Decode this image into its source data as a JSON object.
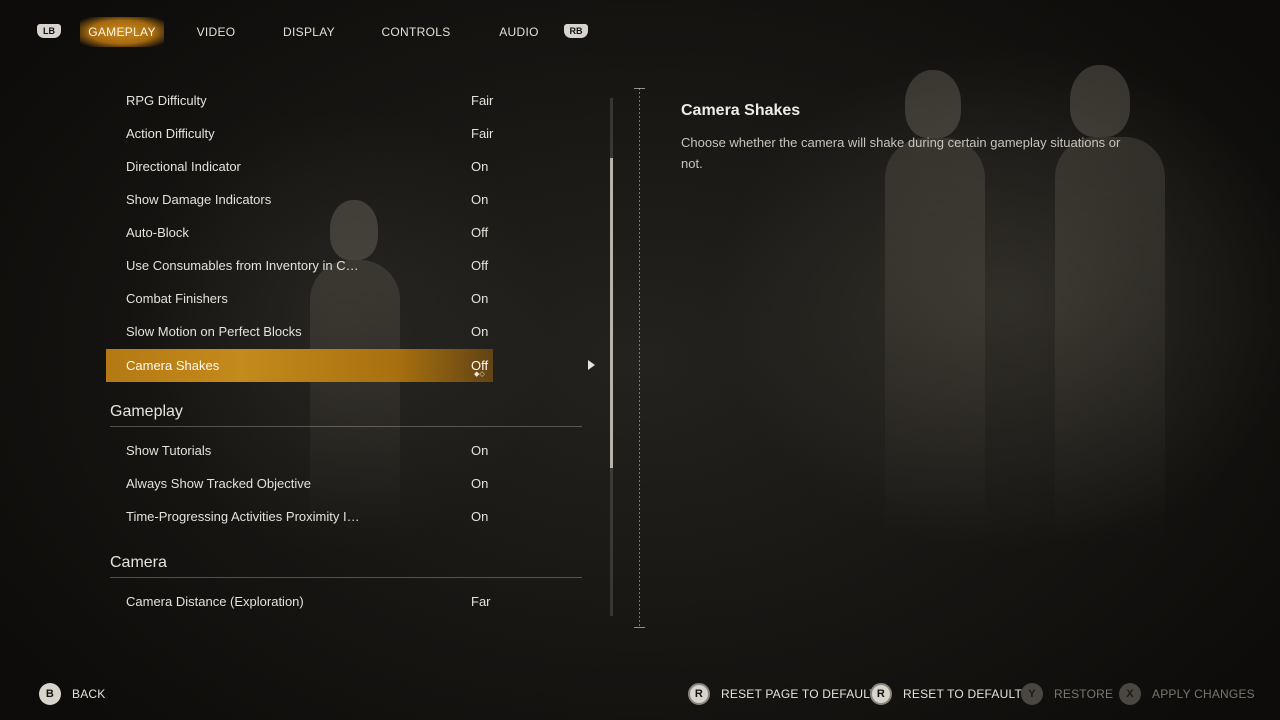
{
  "tabs": {
    "left_bumper": "LB",
    "right_bumper": "RB",
    "items": [
      {
        "label": "GAMEPLAY"
      },
      {
        "label": "VIDEO"
      },
      {
        "label": "DISPLAY"
      },
      {
        "label": "CONTROLS"
      },
      {
        "label": "AUDIO"
      }
    ]
  },
  "settings": {
    "rows": [
      {
        "label": "RPG Difficulty",
        "value": "Fair"
      },
      {
        "label": "Action Difficulty",
        "value": "Fair"
      },
      {
        "label": "Directional Indicator",
        "value": "On"
      },
      {
        "label": "Show Damage Indicators",
        "value": "On"
      },
      {
        "label": "Auto-Block",
        "value": "Off"
      },
      {
        "label": "Use Consumables from Inventory in C…",
        "value": "Off"
      },
      {
        "label": "Combat Finishers",
        "value": "On"
      },
      {
        "label": "Slow Motion on Perfect Blocks",
        "value": "On"
      },
      {
        "label": "Camera Shakes",
        "value": "Off",
        "indicator": "◆◇"
      }
    ],
    "sections": [
      {
        "title": "Gameplay",
        "rows": [
          {
            "label": "Show Tutorials",
            "value": "On"
          },
          {
            "label": "Always Show Tracked Objective",
            "value": "On"
          },
          {
            "label": "Time-Progressing Activities Proximity I…",
            "value": "On"
          }
        ]
      },
      {
        "title": "Camera",
        "rows": [
          {
            "label": "Camera Distance (Exploration)",
            "value": "Far"
          }
        ]
      }
    ]
  },
  "description": {
    "title": "Camera Shakes",
    "text": "Choose whether the camera will shake during certain gameplay situations or not."
  },
  "footer": {
    "back": {
      "glyph": "B",
      "label": "BACK"
    },
    "reset_page": {
      "glyph": "R",
      "label": "RESET PAGE TO DEFAULT"
    },
    "reset": {
      "glyph": "R",
      "label": "RESET TO DEFAULT"
    },
    "restore": {
      "glyph": "Y",
      "label": "RESTORE"
    },
    "apply": {
      "glyph": "X",
      "label": "APPLY CHANGES"
    }
  },
  "colors": {
    "accent": "#c48a1c",
    "background": "#1a1815"
  }
}
